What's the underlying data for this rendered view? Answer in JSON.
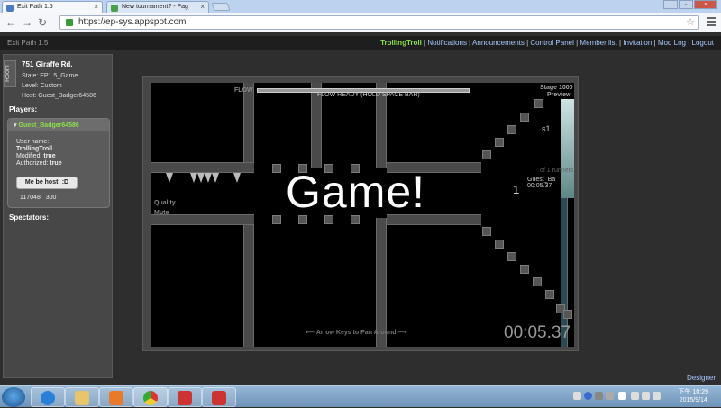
{
  "browser": {
    "tabs": [
      {
        "title": "Exit Path 1.5",
        "active": true
      },
      {
        "title": "New tournament? - Pag",
        "active": false
      }
    ],
    "url": "https://ep-sys.appspot.com",
    "icons": {
      "back": "back-arrow-icon",
      "forward": "forward-arrow-icon",
      "reload": "reload-icon",
      "lock": "lock-icon",
      "star": "star-icon",
      "menu": "menu-icon"
    }
  },
  "topbar": {
    "site_title": "Exit Path 1.5",
    "username": "TrollingTroll",
    "links": [
      "Notifications",
      "Announcements",
      "Control Panel",
      "Member list",
      "Invitation",
      "Mod Log",
      "Logout"
    ]
  },
  "sidebar": {
    "room_tab": "Room",
    "room_name": "751 Giraffe Rd.",
    "state": "State: EP1.5_Game",
    "level": "Level: Custom",
    "host": "Host: Guest_Badger64586",
    "players_heading": "Players:",
    "player": {
      "name": "Guest_Badger64586",
      "user_name_label": "User name:",
      "user_name": "TrollingTroll",
      "modified_label": "Modified:",
      "modified": "true",
      "authorized_label": "Authorized:",
      "authorized": "true",
      "host_button": "Me be host! :D",
      "stat_a": "117048",
      "stat_b": "300"
    },
    "spectators_heading": "Spectators:"
  },
  "game": {
    "overlay": "Game!",
    "flow_label": "FLOW",
    "flow_ready": "FLOW READY (HOLD SPACE BAR)",
    "stage": "Stage 1000",
    "preview": "Preview",
    "s1": "s1",
    "of_label": "of 1 runners",
    "quality": "Quality",
    "mute": "Mute",
    "leader_rank": "1",
    "leader_name": "Guest_Ba",
    "leader_time": "00:05.37",
    "pan_hint": "Arrow Keys to Pan Around",
    "timer": "00:05.37"
  },
  "footer": {
    "designer": "Designer"
  },
  "taskbar": {
    "time": "下午 10:29",
    "date": "2015/9/14",
    "apps": [
      "ie-icon",
      "explorer-icon",
      "media-player-icon",
      "chrome-icon",
      "exit-path-icon",
      "exit-path-icon-2"
    ]
  }
}
